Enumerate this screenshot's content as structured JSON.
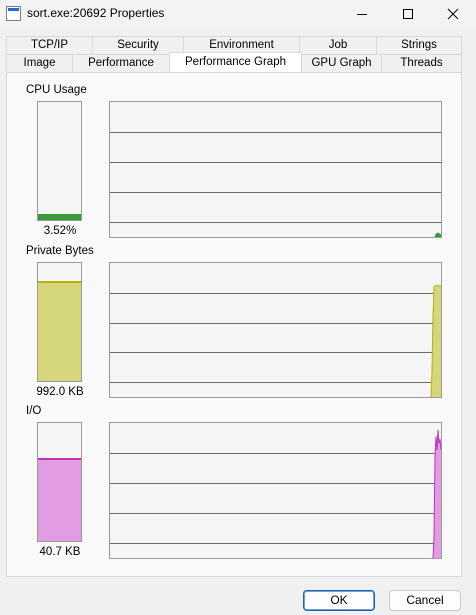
{
  "window": {
    "title": "sort.exe:20692 Properties"
  },
  "tabs_row1": [
    "TCP/IP",
    "Security",
    "Environment",
    "Job",
    "Strings"
  ],
  "tabs_row2": [
    "Image",
    "Performance",
    "Performance Graph",
    "GPU Graph",
    "Threads"
  ],
  "active_tab": "Performance Graph",
  "cpu": {
    "label": "CPU Usage",
    "value_text": "3.52%",
    "level": 0.0352,
    "color": "#3a9a3a",
    "fill": "#3a9a3a"
  },
  "private_bytes": {
    "label": "Private Bytes",
    "value_text": "992.0 KB",
    "level": 0.83,
    "color": "#b5b300",
    "fill": "#d6d67d"
  },
  "io": {
    "label": "I/O",
    "value_text": "40.7  KB",
    "level": 0.69,
    "color": "#c030c0",
    "fill": "#e29ce2"
  },
  "buttons": {
    "ok": "OK",
    "cancel": "Cancel"
  }
}
